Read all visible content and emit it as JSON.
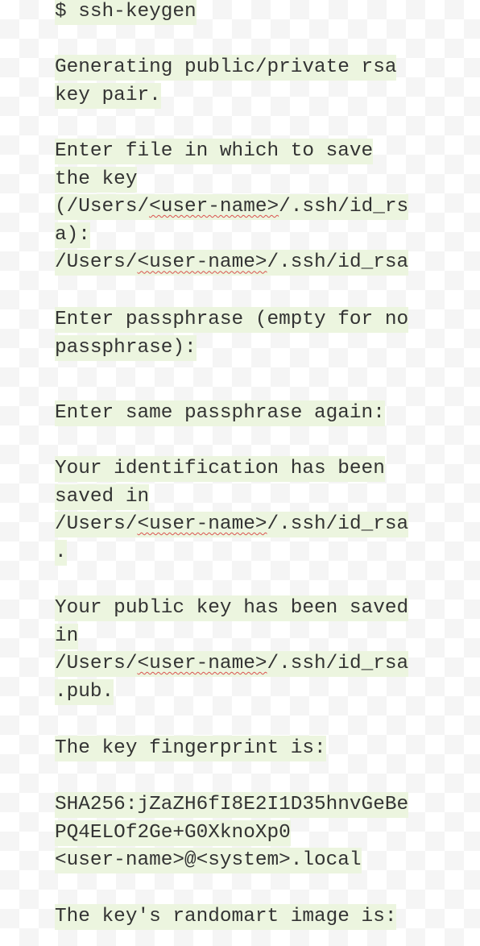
{
  "command": "$ ssh-keygen",
  "gen_l1": "Generating public/private rsa",
  "gen_l2": "key pair.",
  "file_l1": "Enter file in which to save",
  "file_l2": "the key",
  "file_l3_pre": "(/Users/",
  "file_l3_user": "<user-name>",
  "file_l3_post": "/.ssh/id_rs",
  "file_l4": "a):",
  "file_l5_pre": "/Users/",
  "file_l5_user": "<user-name>",
  "file_l5_post": "/.ssh/id_rsa",
  "pass_l1": "Enter passphrase (empty for no",
  "pass_l2": "passphrase):",
  "same": "Enter same passphrase again:",
  "ident_l1": "Your identification has been",
  "ident_l2": "saved in",
  "ident_l3_pre": "/Users/",
  "ident_l3_user": "<user-name>",
  "ident_l3_post": "/.ssh/id_rsa",
  "ident_l4": ".",
  "pub_l1": "Your public key has been saved",
  "pub_l2": "in",
  "pub_l3_pre": "/Users/",
  "pub_l3_user": "<user-name>",
  "pub_l3_post": "/.ssh/id_rsa",
  "pub_l4": ".pub.",
  "fp_label": "The key fingerprint is:",
  "fp_l1": "SHA256:jZaZH6fI8E2I1D35hnvGeBe",
  "fp_l2": "PQ4ELOf2Ge+G0XknoXp0",
  "fp_l3": "<user-name>@<system>.local",
  "randomart": "The key's randomart image is:"
}
